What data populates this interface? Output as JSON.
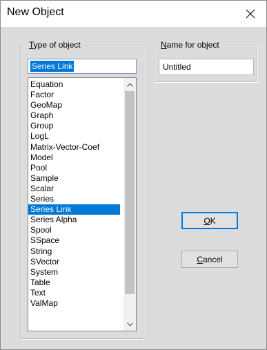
{
  "window": {
    "title": "New Object",
    "close_glyph": "X"
  },
  "type_group": {
    "label_mnemonic": "T",
    "label_rest": "ype of object",
    "input_value": "Series Link",
    "items": [
      "Equation",
      "Factor",
      "GeoMap",
      "Graph",
      "Group",
      "LogL",
      "Matrix-Vector-Coef",
      "Model",
      "Pool",
      "Sample",
      "Scalar",
      "Series",
      "Series Link",
      "Series Alpha",
      "Spool",
      "SSpace",
      "String",
      "SVector",
      "System",
      "Table",
      "Text",
      "ValMap"
    ],
    "selected_item": "Series Link"
  },
  "name_group": {
    "label_mnemonic": "N",
    "label_rest": "ame for object",
    "input_value": "Untitled"
  },
  "buttons": {
    "ok_mnemonic": "O",
    "ok_rest": "K",
    "cancel_mnemonic": "C",
    "cancel_rest": "ancel"
  },
  "colors": {
    "selection": "#0078d7",
    "dialog_bg": "#dcdcdc"
  }
}
